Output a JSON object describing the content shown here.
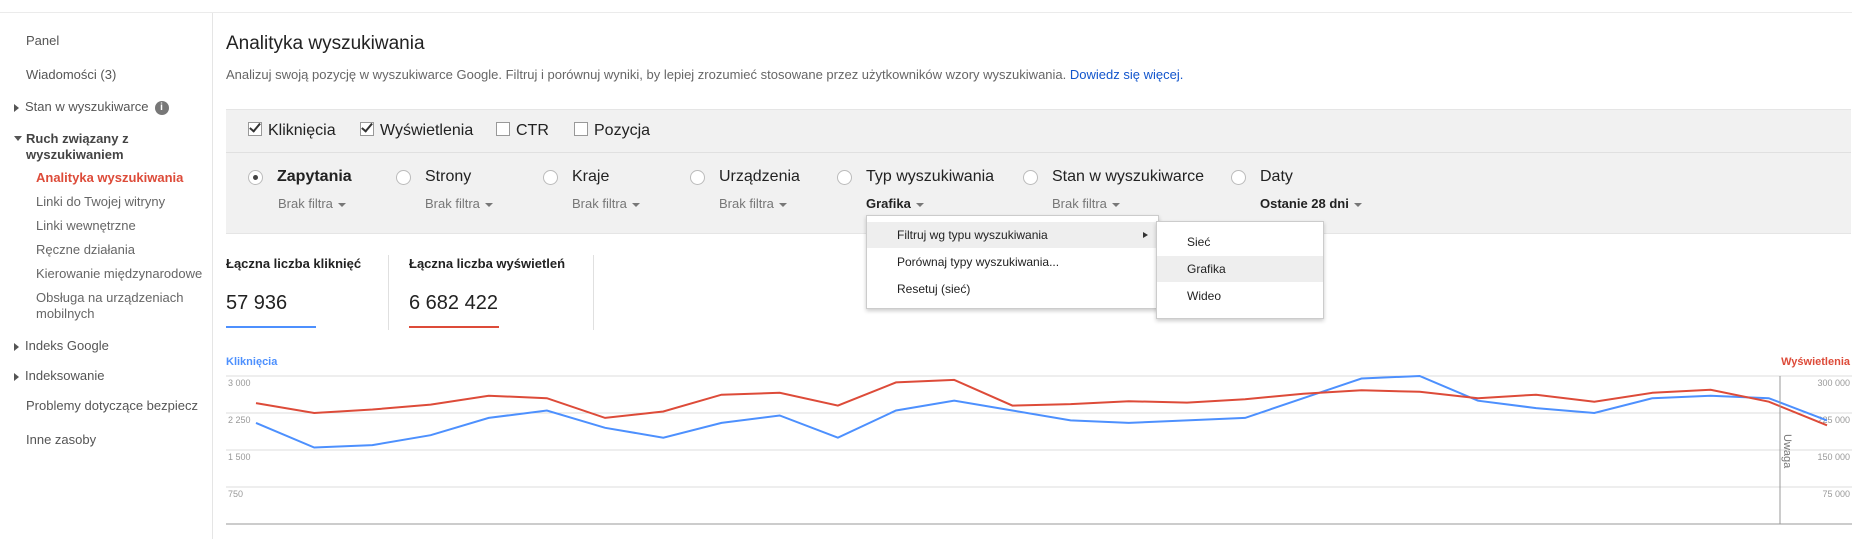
{
  "sidebar": {
    "panel": "Panel",
    "messages": "Wiadomości (3)",
    "search_status": "Stan w wyszukiwarce",
    "search_traffic": "Ruch związany z wyszukiwaniem",
    "search_traffic_items": [
      "Analityka wyszukiwania",
      "Linki do Twojej witryny",
      "Linki wewnętrzne",
      "Ręczne działania",
      "Kierowanie międzynarodowe",
      "Obsługa na urządzeniach mobilnych"
    ],
    "google_index": "Indeks Google",
    "crawl": "Indeksowanie",
    "security": "Problemy dotyczące bezpiecz",
    "other": "Inne zasoby",
    "info_glyph": "i"
  },
  "header": {
    "title": "Analityka wyszukiwania",
    "subtitle": "Analizuj swoją pozycję w wyszukiwarce Google. Filtruj i porównuj wyniki, by lepiej zrozumieć stosowane przez użytkowników wzory wyszukiwania.",
    "learn_more": "Dowiedz się więcej."
  },
  "metrics": {
    "clicks": {
      "label": "Kliknięcia",
      "checked": true
    },
    "impressions": {
      "label": "Wyświetlenia",
      "checked": true
    },
    "ctr": {
      "label": "CTR",
      "checked": false
    },
    "position": {
      "label": "Pozycja",
      "checked": false
    }
  },
  "dimensions": [
    {
      "label": "Zapytania",
      "filter": "Brak filtra",
      "selected": true
    },
    {
      "label": "Strony",
      "filter": "Brak filtra",
      "selected": false
    },
    {
      "label": "Kraje",
      "filter": "Brak filtra",
      "selected": false
    },
    {
      "label": "Urządzenia",
      "filter": "Brak filtra",
      "selected": false
    },
    {
      "label": "Typ wyszukiwania",
      "filter": "Grafika",
      "selected": false
    },
    {
      "label": "Stan w wyszukiwarce",
      "filter": "Brak filtra",
      "selected": false
    },
    {
      "label": "Daty",
      "filter": "Ostanie 28 dni",
      "selected": false
    }
  ],
  "menu": {
    "items": [
      "Filtruj wg typu wyszukiwania",
      "Porównaj typy wyszukiwania...",
      "Resetuj (sieć)"
    ],
    "submenu": [
      "Sieć",
      "Grafika",
      "Wideo"
    ]
  },
  "totals": {
    "clicks_label": "Łączna liczba kliknięć",
    "clicks_value": "57 936",
    "impressions_label": "Łączna liczba wyświetleń",
    "impressions_value": "6 682 422"
  },
  "colors": {
    "clicks": "#4d90fe",
    "impressions": "#dd4b39",
    "active": "#dd4b39",
    "link": "#1155cc"
  },
  "chart_data": {
    "type": "line",
    "left_axis_label": "Kliknięcia",
    "right_axis_label": "Wyświetlenia",
    "left_ticks": [
      "3 000",
      "2 250",
      "1 500",
      "750"
    ],
    "right_ticks": [
      "300 000",
      "225 000",
      "150 000",
      "75 000"
    ],
    "left_ylim": [
      0,
      3000
    ],
    "right_ylim": [
      0,
      300000
    ],
    "annotation": "Uwaga",
    "series": [
      {
        "name": "Kliknięcia",
        "axis": "left",
        "values": [
          2050,
          1550,
          1600,
          1800,
          2150,
          2300,
          1950,
          1750,
          2050,
          2200,
          1750,
          2300,
          2500,
          2300,
          2100,
          2050,
          2100,
          2150,
          2550,
          2950,
          3000,
          2500,
          2350,
          2250,
          2550,
          2600,
          2550,
          2100
        ]
      },
      {
        "name": "Wyświetlenia",
        "axis": "right",
        "values": [
          245000,
          225000,
          232000,
          242000,
          260000,
          255000,
          215000,
          228000,
          262000,
          266000,
          240000,
          287000,
          292000,
          240000,
          243000,
          249000,
          246000,
          253000,
          264000,
          271000,
          268000,
          255000,
          262000,
          248000,
          266000,
          272000,
          248000,
          200000
        ]
      }
    ]
  }
}
